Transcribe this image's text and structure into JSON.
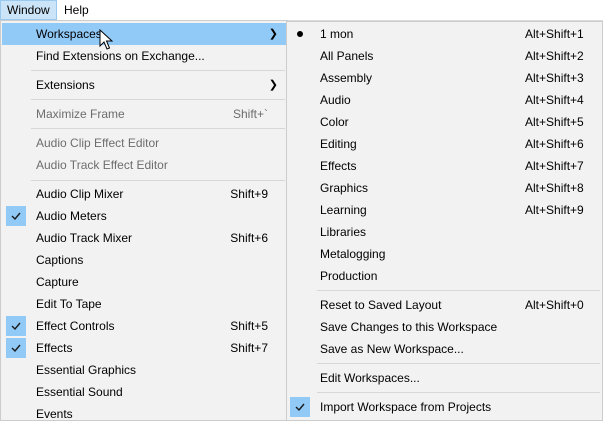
{
  "menubar": {
    "window": "Window",
    "help": "Help"
  },
  "window_menu": {
    "workspaces": "Workspaces",
    "find_extensions": "Find Extensions on Exchange...",
    "extensions": "Extensions",
    "maximize_frame": {
      "label": "Maximize Frame",
      "shortcut": "Shift+`"
    },
    "audio_clip_effect_editor": "Audio Clip Effect Editor",
    "audio_track_effect_editor": "Audio Track Effect Editor",
    "audio_clip_mixer": {
      "label": "Audio Clip Mixer",
      "shortcut": "Shift+9"
    },
    "audio_meters": "Audio Meters",
    "audio_track_mixer": {
      "label": "Audio Track Mixer",
      "shortcut": "Shift+6"
    },
    "captions": "Captions",
    "capture": "Capture",
    "edit_to_tape": "Edit To Tape",
    "effect_controls": {
      "label": "Effect Controls",
      "shortcut": "Shift+5"
    },
    "effects": {
      "label": "Effects",
      "shortcut": "Shift+7"
    },
    "essential_graphics": "Essential Graphics",
    "essential_sound": "Essential Sound",
    "events": "Events"
  },
  "workspaces_menu": {
    "items": [
      {
        "label": "1 mon",
        "shortcut": "Alt+Shift+1"
      },
      {
        "label": "All Panels",
        "shortcut": "Alt+Shift+2"
      },
      {
        "label": "Assembly",
        "shortcut": "Alt+Shift+3"
      },
      {
        "label": "Audio",
        "shortcut": "Alt+Shift+4"
      },
      {
        "label": "Color",
        "shortcut": "Alt+Shift+5"
      },
      {
        "label": "Editing",
        "shortcut": "Alt+Shift+6"
      },
      {
        "label": "Effects",
        "shortcut": "Alt+Shift+7"
      },
      {
        "label": "Graphics",
        "shortcut": "Alt+Shift+8"
      },
      {
        "label": "Learning",
        "shortcut": "Alt+Shift+9"
      },
      {
        "label": "Libraries",
        "shortcut": ""
      },
      {
        "label": "Metalogging",
        "shortcut": ""
      },
      {
        "label": "Production",
        "shortcut": ""
      }
    ],
    "reset_layout": {
      "label": "Reset to Saved Layout",
      "shortcut": "Alt+Shift+0"
    },
    "save_changes": "Save Changes to this Workspace",
    "save_new": "Save as New Workspace...",
    "edit_workspaces": "Edit Workspaces...",
    "import_workspace": "Import Workspace from Projects"
  },
  "icons": {
    "checkmark": "checkmark-icon",
    "bullet": "radio-bullet-icon",
    "submenu_arrow": "chevron-right-icon",
    "cursor": "mouse-pointer-icon"
  },
  "colors": {
    "highlight": "#91c9f7",
    "menu_bg": "#f2f2f2",
    "disabled_text": "#6d6d6d",
    "menubar_active": "#cce4f7"
  }
}
